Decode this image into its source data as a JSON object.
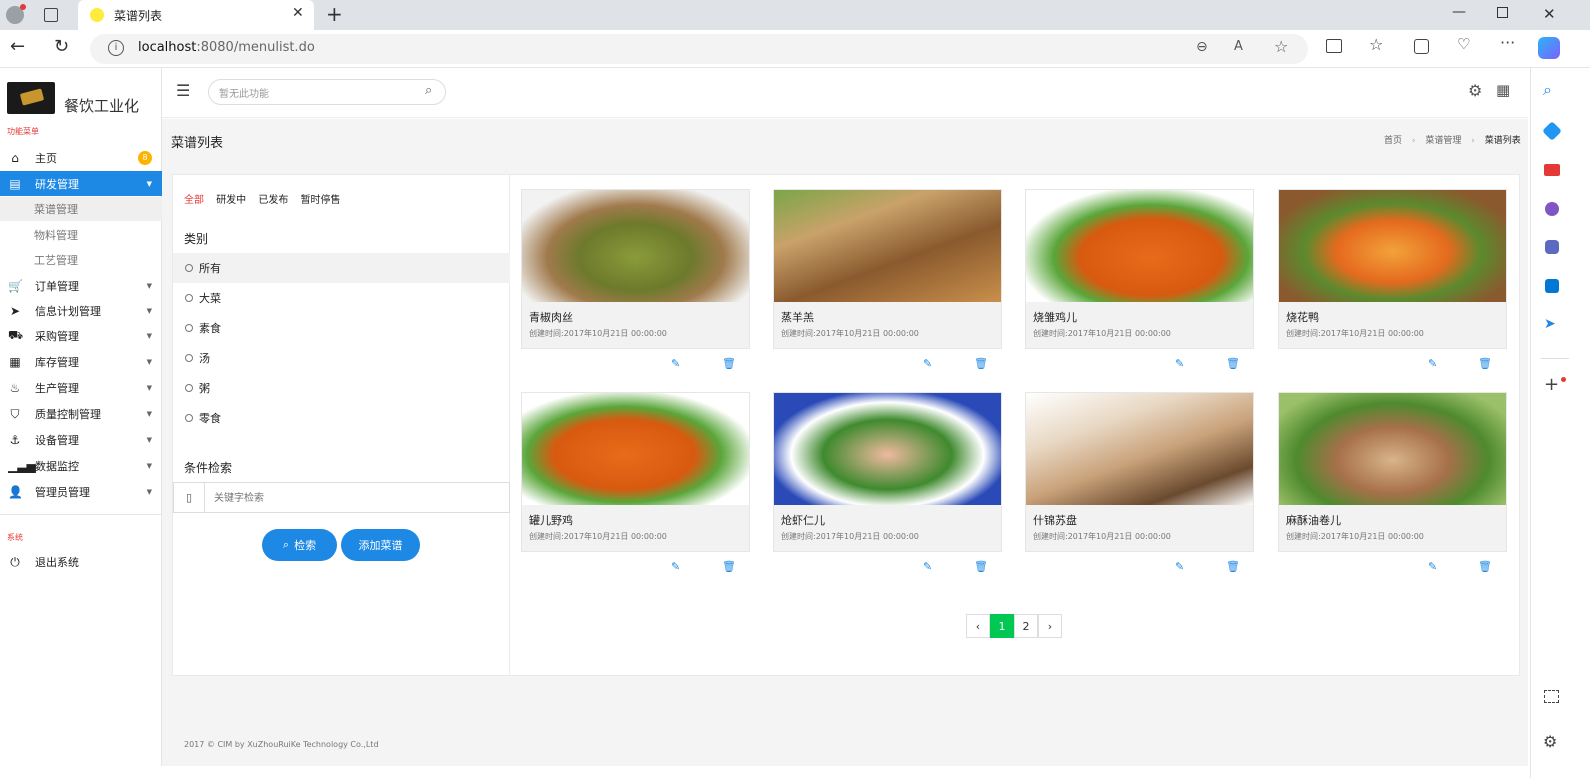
{
  "browser": {
    "tab_title": "菜谱列表",
    "url_host": "localhost",
    "url_rest": ":8080/menulist.do"
  },
  "app": {
    "brand": "餐饮工业化",
    "search_placeholder": "暂无此功能",
    "page_title": "菜谱列表",
    "breadcrumb": [
      "首页",
      "菜谱管理",
      "菜谱列表"
    ],
    "footer": "2017 © CIM by XuZhouRuiKe Technology Co.,Ltd"
  },
  "sidebar": {
    "section_label": "功能菜单",
    "badge": "8",
    "items": [
      {
        "label": "主页",
        "icon": "home-icon"
      },
      {
        "label": "研发管理",
        "icon": "book-icon"
      },
      {
        "label": "订单管理",
        "icon": "cart-icon"
      },
      {
        "label": "信息计划管理",
        "icon": "send-icon"
      },
      {
        "label": "采购管理",
        "icon": "truck-icon"
      },
      {
        "label": "库存管理",
        "icon": "grid-icon"
      },
      {
        "label": "生产管理",
        "icon": "fire-icon"
      },
      {
        "label": "质量控制管理",
        "icon": "html5-icon"
      },
      {
        "label": "设备管理",
        "icon": "anchor-icon"
      },
      {
        "label": "数据监控",
        "icon": "signal-icon"
      },
      {
        "label": "管理员管理",
        "icon": "user-icon"
      }
    ],
    "sub_items": [
      "菜谱管理",
      "物料管理",
      "工艺管理"
    ],
    "system_label": "系统",
    "logout": "退出系统"
  },
  "filters": {
    "status_tabs": [
      "全部",
      "研发中",
      "已发布",
      "暂时停售"
    ],
    "category_title": "类别",
    "categories": [
      "所有",
      "大菜",
      "素食",
      "汤",
      "粥",
      "零食"
    ],
    "search_title": "条件检索",
    "keyword_placeholder": "关键字检索",
    "search_btn": "检索",
    "add_btn": "添加菜谱"
  },
  "cards": [
    {
      "name": "青椒肉丝",
      "time": "创建时间:2017年10月21日 00:00:00"
    },
    {
      "name": "蒸羊羔",
      "time": "创建时间:2017年10月21日 00:00:00"
    },
    {
      "name": "烧雏鸡儿",
      "time": "创建时间:2017年10月21日 00:00:00"
    },
    {
      "name": "烧花鸭",
      "time": "创建时间:2017年10月21日 00:00:00"
    },
    {
      "name": "罐儿野鸡",
      "time": "创建时间:2017年10月21日 00:00:00"
    },
    {
      "name": "炝虾仁儿",
      "time": "创建时间:2017年10月21日 00:00:00"
    },
    {
      "name": "什锦苏盘",
      "time": "创建时间:2017年10月21日 00:00:00"
    },
    {
      "name": "麻酥油卷儿",
      "time": "创建时间:2017年10月21日 00:00:00"
    }
  ],
  "pagination": {
    "prev": "‹",
    "pages": [
      "1",
      "2"
    ],
    "next": "›",
    "current": "1"
  },
  "colors": {
    "accent": "#1e88e5",
    "active_tab": "#e53935",
    "page_active": "#00c853",
    "badge": "#ffb300"
  }
}
